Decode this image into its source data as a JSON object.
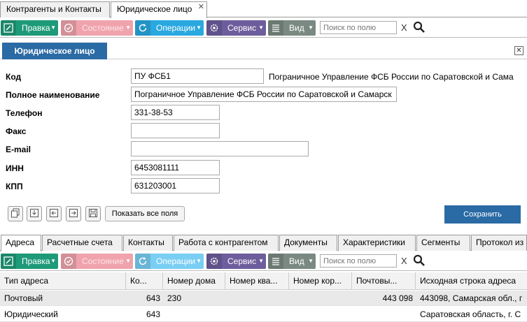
{
  "top_tabs": [
    {
      "label": "Контрагенты и Контакты"
    },
    {
      "label": "Юридическое лицо",
      "close": "✕"
    }
  ],
  "toolbar": {
    "pravka": "Правка",
    "sostoyanie": "Состояние",
    "operacii": "Операции",
    "servis": "Сервис",
    "vid": "Вид",
    "search_placeholder": "Поиск по полю",
    "clear": "X"
  },
  "panel": {
    "title": "Юридическое лицо"
  },
  "form": {
    "kod_label": "Код",
    "kod_value": "ПУ ФСБ1",
    "kod_extra": "Пограничное Управление ФСБ России по Саратовской и Сама",
    "full_name_label": "Полное наименование",
    "full_name_value": "Пограничное Управление ФСБ России по Саратовской и Самарск",
    "phone_label": "Телефон",
    "phone_value": "331-38-53",
    "fax_label": "Факс",
    "fax_value": "",
    "email_label": "E-mail",
    "email_value": "",
    "inn_label": "ИНН",
    "inn_value": "6453081111",
    "kpp_label": "КПП",
    "kpp_value": "631203001",
    "show_all": "Показать все поля",
    "save": "Сохранить"
  },
  "bottom_tabs": [
    "Адреса",
    "Расчетные счета",
    "Контакты",
    "Работа с контрагентом",
    "Документы",
    "Характеристики",
    "Сегменты",
    "Протокол из"
  ],
  "grid": {
    "columns": [
      "Тип адреса",
      "Ко...",
      "Номер дома",
      "Номер ква...",
      "Номер кор...",
      "Почтовы...",
      "Исходная строка адреса"
    ],
    "rows": [
      {
        "type": "Почтовый",
        "code": "643",
        "house": "230",
        "apt": "",
        "corp": "",
        "post": "443 098",
        "src": "443098, Самарская обл., г"
      },
      {
        "type": "Юридический",
        "code": "643",
        "house": "",
        "apt": "",
        "corp": "",
        "post": "",
        "src": "Саратовская область, г. С"
      }
    ]
  },
  "colors": {
    "pravka": "#1e9a78",
    "sostoyanie": "#f0a3ad",
    "operacii": "#2aa8e0",
    "operacii_disabled": "#79cef3",
    "servis": "#6d5d9c",
    "vid": "#7a8a82",
    "accent": "#2a6aa5"
  }
}
